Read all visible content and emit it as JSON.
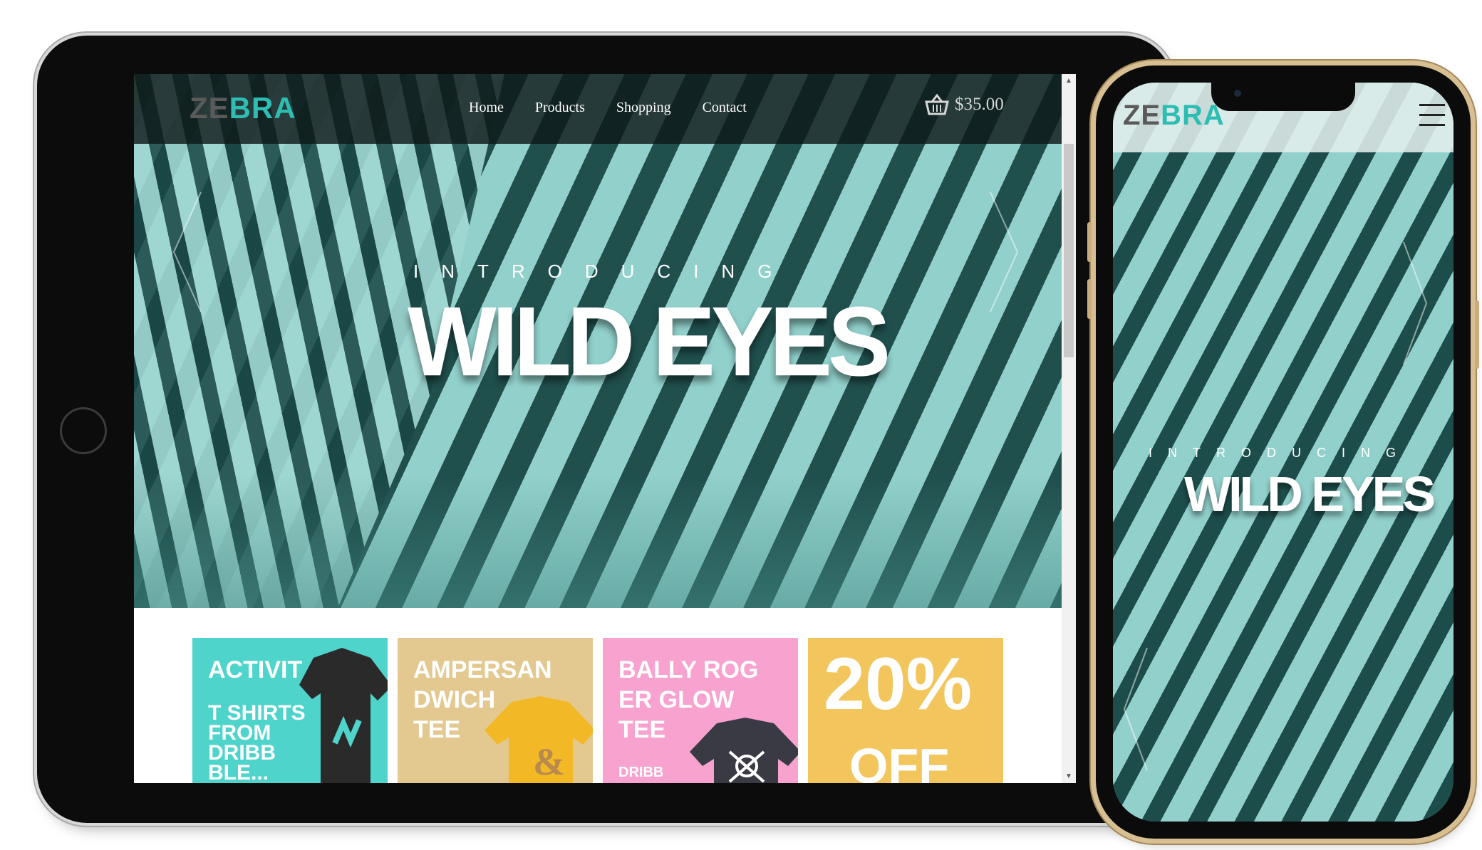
{
  "brand": {
    "logo_part1": "ZE",
    "logo_part2": "BRA",
    "accent": "#2dbdb2",
    "logo_gray": "#5a5a5a",
    "hero_teal": "#3f8e89"
  },
  "tablet": {
    "nav": {
      "items": [
        {
          "label": "Home"
        },
        {
          "label": "Products"
        },
        {
          "label": "Shopping"
        },
        {
          "label": "Contact"
        }
      ],
      "cart_icon": "basket-icon",
      "cart_total": "$35.00"
    },
    "hero": {
      "kicker": "INTRODUCING",
      "headline": "WILD EYES",
      "prev_icon": "chevron-left-icon",
      "next_icon": "chevron-right-icon"
    },
    "products": [
      {
        "title": "ACTIVIT",
        "subtitle": "T SHIRTS\nFROM\nDRIBB\nBLE...",
        "color": "#4fd4cc"
      },
      {
        "title": "AMPERSAN\nDWICH\nTEE",
        "color": "#e3c98f"
      },
      {
        "title": "BALLY ROG\nER GLOW\nTEE",
        "small": "DRIBB",
        "color": "#f7a2cf"
      },
      {
        "big": "20%",
        "big_off": "OFF",
        "color": "#f2c65d"
      }
    ]
  },
  "phone": {
    "menu_icon": "hamburger-menu-icon",
    "hero": {
      "kicker": "INTRODUCING",
      "headline": "WILD EYES"
    }
  }
}
